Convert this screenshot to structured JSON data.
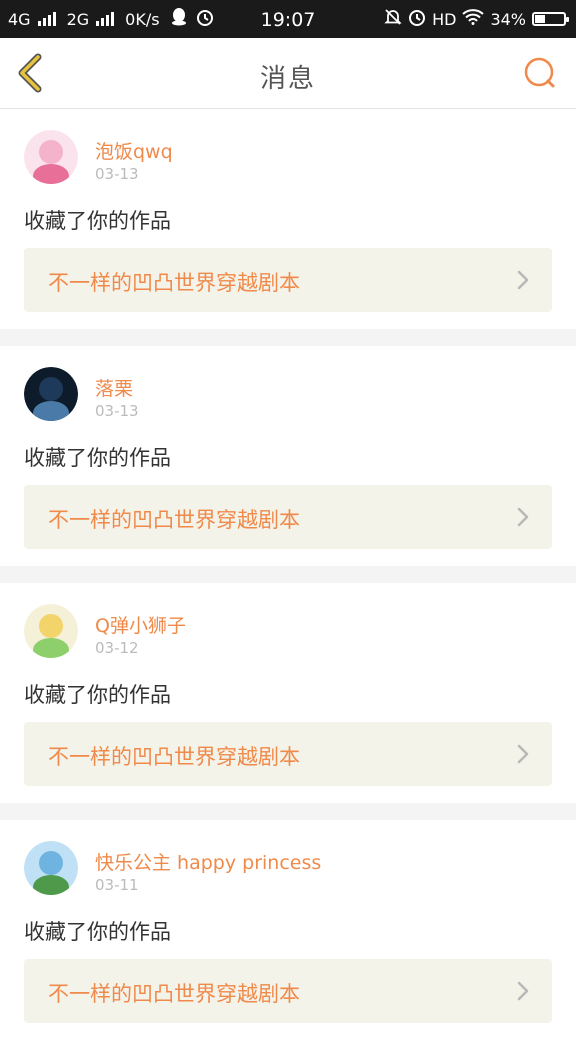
{
  "status": {
    "net1": "4G",
    "net2": "2G",
    "speed": "0K/s",
    "time": "19:07",
    "hd": "HD",
    "battery": "34%",
    "battery_level": 0.34
  },
  "header": {
    "title": "消息",
    "back_icon": "chevron-left-icon",
    "search_icon": "search-icon",
    "accent_color": "#f08a4b",
    "back_color": "#e8c43c"
  },
  "messages": [
    {
      "user": "泡饭qwq",
      "date": "03-13",
      "action": "收藏了你的作品",
      "work": "不一样的凹凸世界穿越剧本",
      "avatar_colors": [
        "#fbe3ee",
        "#f4b3cb",
        "#e76f98"
      ]
    },
    {
      "user": "落栗",
      "date": "03-13",
      "action": "收藏了你的作品",
      "work": "不一样的凹凸世界穿越剧本",
      "avatar_colors": [
        "#0d1b2a",
        "#1e3a5a",
        "#4a7ba8"
      ]
    },
    {
      "user": "Q弹小狮子",
      "date": "03-12",
      "action": "收藏了你的作品",
      "work": "不一样的凹凸世界穿越剧本",
      "avatar_colors": [
        "#f5f0d8",
        "#f2d46a",
        "#8ccf6b"
      ]
    },
    {
      "user": "快乐公主 happy princess",
      "date": "03-11",
      "action": "收藏了你的作品",
      "work": "不一样的凹凸世界穿越剧本",
      "avatar_colors": [
        "#bfe0f5",
        "#6fb3e0",
        "#4f9a4a"
      ]
    }
  ]
}
